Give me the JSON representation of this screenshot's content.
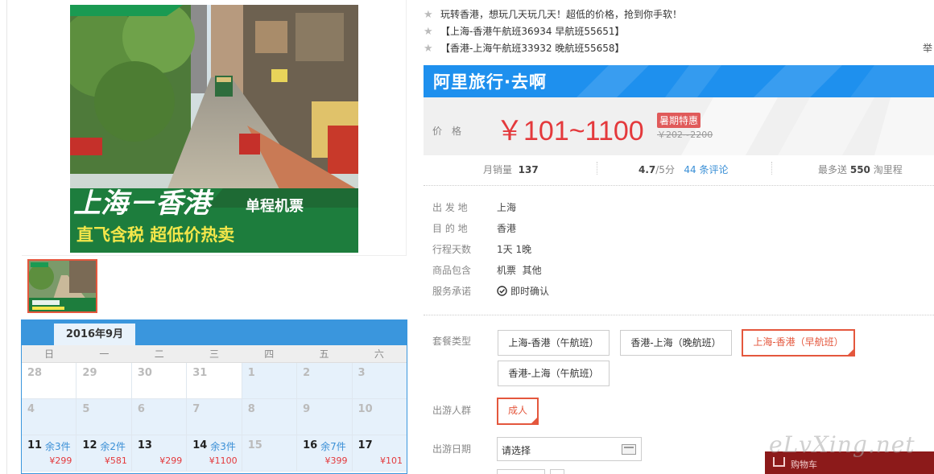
{
  "gallery": {
    "main_image_alt": "上海－香港 单程机票 直飞含税 超低价热卖",
    "title_line1": "上海－香港",
    "title_tag": "单程机票",
    "title_line2": "直飞含税 超低价热卖"
  },
  "calendar": {
    "month": "2016年9月",
    "weekdays": [
      "日",
      "一",
      "二",
      "三",
      "四",
      "五",
      "六"
    ],
    "rows": [
      [
        {
          "day": "28",
          "left": "",
          "price": ""
        },
        {
          "day": "29",
          "left": "",
          "price": ""
        },
        {
          "day": "30",
          "left": "",
          "price": ""
        },
        {
          "day": "31",
          "left": "",
          "price": ""
        },
        {
          "day": "1",
          "left": "",
          "price": ""
        },
        {
          "day": "2",
          "left": "",
          "price": ""
        },
        {
          "day": "3",
          "left": "",
          "price": ""
        }
      ],
      [
        {
          "day": "4",
          "left": "",
          "price": ""
        },
        {
          "day": "5",
          "left": "",
          "price": ""
        },
        {
          "day": "6",
          "left": "",
          "price": ""
        },
        {
          "day": "7",
          "left": "",
          "price": ""
        },
        {
          "day": "8",
          "left": "",
          "price": ""
        },
        {
          "day": "9",
          "left": "",
          "price": ""
        },
        {
          "day": "10",
          "left": "",
          "price": ""
        }
      ],
      [
        {
          "day": "11",
          "left": "余3件",
          "price": "¥299"
        },
        {
          "day": "12",
          "left": "余2件",
          "price": "¥581"
        },
        {
          "day": "13",
          "left": "",
          "price": "¥299"
        },
        {
          "day": "14",
          "left": "余3件",
          "price": "¥1100"
        },
        {
          "day": "15",
          "left": "",
          "price": ""
        },
        {
          "day": "16",
          "left": "余7件",
          "price": "¥399"
        },
        {
          "day": "17",
          "left": "",
          "price": "¥101"
        }
      ]
    ]
  },
  "notes": [
    "玩转香港，想玩几天玩几天！超低的价格，抢到你手软！",
    "【上海-香港午航班36934 早航班55651】",
    "【香港-上海午航班33932 晚航班55658】"
  ],
  "tail_text": "举",
  "banner": {
    "title": "阿里旅行·去啊"
  },
  "price": {
    "label": "价格",
    "value": "￥101~1100",
    "promo": "暑期特惠",
    "old": "￥202~2200"
  },
  "stats": {
    "sales_label": "月销量",
    "sales_value": "137",
    "rating": "4.7",
    "rating_unit": "/5分",
    "reviews": "44 条评论",
    "mileage_prefix": "最多送",
    "mileage_value": "550",
    "mileage_suffix": "淘里程"
  },
  "info": [
    {
      "k": "出 发 地",
      "v": "上海"
    },
    {
      "k": "目 的 地",
      "v": "香港"
    },
    {
      "k": "行程天数",
      "v": "1天 1晚"
    },
    {
      "k": "商品包含",
      "v": "机票  其他"
    },
    {
      "k": "服务承诺",
      "v": "即时确认"
    }
  ],
  "options": {
    "package_label": "套餐类型",
    "packages": [
      "上海-香港（午航班）",
      "香港-上海（晚航班）",
      "上海-香港（早航班）",
      "香港-上海（午航班）"
    ],
    "crowd_label": "出游人群",
    "crowd": "成人",
    "date_label": "出游日期",
    "date_placeholder": "请选择"
  },
  "cart": {
    "label": "购物车"
  },
  "watermark": "eLvXing.net"
}
